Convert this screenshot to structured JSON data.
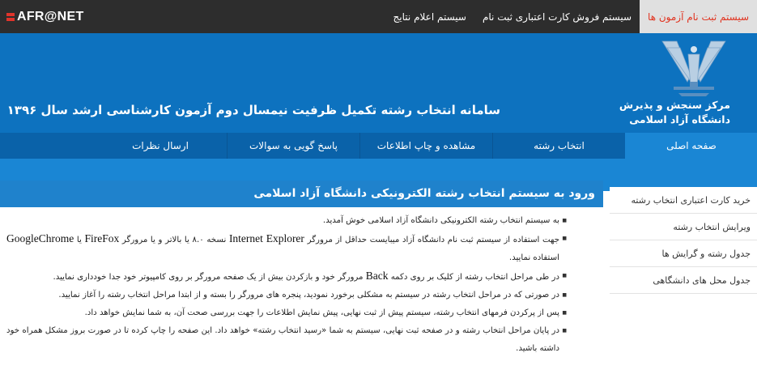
{
  "brand": {
    "text": "AFR@NET",
    "accent": "#e0342b"
  },
  "topnav": [
    {
      "label": "سیستم ثبت نام آزمون ها",
      "active": true
    },
    {
      "label": "سیستم فروش کارت اعتباری ثبت نام",
      "active": false
    },
    {
      "label": "سیستم اعلام نتایج",
      "active": false
    }
  ],
  "header": {
    "org_line1": "مرکز سنجش و پذیرش",
    "org_line2": "دانشگاه آزاد اسلامی",
    "system_title": "سامانه انتخاب رشته تکمیل ظرفیت نیمسال دوم آزمون کارشناسی ارشد سال ۱۳۹۶",
    "logo_icon": "university-logo-icon"
  },
  "mainnav": [
    {
      "label": "صفحه اصلی",
      "active": true
    },
    {
      "label": "انتخاب رشته",
      "active": false
    },
    {
      "label": "مشاهده و چاپ اطلاعات",
      "active": false
    },
    {
      "label": "پاسخ گویی به سوالات",
      "active": false
    },
    {
      "label": "ارسال نظرات",
      "active": false
    }
  ],
  "content": {
    "title": "ورود به سیستم انتخاب رشته الکترونیکی دانشگاه آزاد اسلامی",
    "b1": "به سیستم انتخاب رشته الکترونیکی دانشگاه آزاد اسلامی خوش آمدید.",
    "b2": {
      "t1": "جهت استفاده از سیستم ثبت نام دانشگاه آزاد میبایست حداقل از مرورگر ",
      "ie": "Internet Explorer",
      "t2": " نسخه ۸.۰ یا بالاتر و یا مرورگر ",
      "ff": "FireFox",
      "t3": " یا ",
      "gc": "GoogleChrome",
      "t4": " استفاده نمایید."
    },
    "b3": {
      "t1": "در طی مراحل انتخاب رشته از کلیک بر روی دکمه ",
      "back": "Back",
      "t2": " مرورگر خود و بازکردن بیش از یک صفحه مرورگر بر روی کامپیوتر خود جدا خودداری نمایید."
    },
    "b4": "در صورتی که در مراحل انتخاب رشته در سیستم به مشکلی برخورد نمودید، پنجره های مرورگر را بسته و از ابتدا مراحل انتخاب رشته را آغاز نمایید.",
    "b5": "پس از پرکردن فرمهای انتخاب رشته، سیستم پیش از ثبت نهایی، پیش نمایش اطلاعات را جهت بررسی صحت آن، به شما نمایش خواهد داد.",
    "b6": "در پایان مراحل انتخاب رشته و در صفحه ثبت نهایی، سیستم به شما «رسید انتخاب رشته» خواهد داد. این صفحه را چاپ کرده تا در صورت بروز مشکل همراه خود داشته باشید."
  },
  "sidebar": [
    {
      "label": "خرید کارت اعتباری انتخاب رشته"
    },
    {
      "label": "ویرایش انتخاب رشته"
    },
    {
      "label": "جدول رشته و گرایش ها"
    },
    {
      "label": "جدول محل های دانشگاهی"
    }
  ],
  "colors": {
    "topbar": "#2d2d2d",
    "header_blue": "#0d72bf",
    "nav_blue": "#0a62a9",
    "band_blue": "#1a86d4",
    "active_tab_text": "#e1331f"
  }
}
